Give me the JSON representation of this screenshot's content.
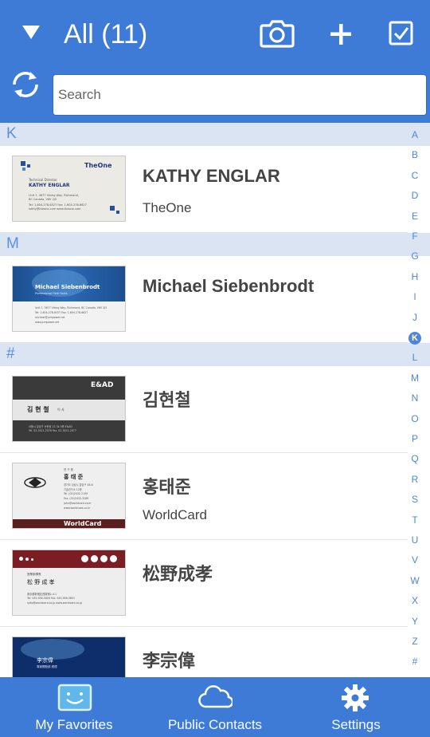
{
  "header": {
    "title": "All (11)",
    "search_placeholder": "Search"
  },
  "sections": [
    {
      "letter": "K"
    },
    {
      "letter": "M"
    },
    {
      "letter": "#"
    }
  ],
  "contacts": [
    {
      "name": "KATHY ENGLAR",
      "company": "TheOne",
      "card": {
        "brand": "TheOne",
        "title_line": "Technical Director",
        "name_line": "KATHY ENGLAR",
        "addr1": "Unit 7, 3677 Viking Way, Richmond,",
        "addr2": "BC Canada, V6V 2J5",
        "phone": "Tel: 1-604-278-6527     Fax: 1-604-278-6627",
        "web": "kathy@theone.com     www.theone.com"
      }
    },
    {
      "name": "Michael Siebenbrodt",
      "company": "",
      "card": {
        "name_line": "Michael Siebenbrodt",
        "title_line": "Professional Field Sales",
        "addr1": "Unit 7, 3677 Viking Way, Richmond, BC Canada, V6V 2J5",
        "phone": "Tel: 1-604-278-6337   Fax: 1-604-278-6627",
        "web": "michael@jumpower.net",
        "web2": "www.jumpower.net"
      }
    },
    {
      "name": "김현철",
      "company": "",
      "card": {
        "brand": "E&AD",
        "name_line": "김 현 철",
        "title_line": "이 사",
        "addr1": "서울시 강남구 논현동 12-34 5층 E&AD",
        "phone": "Tel. 02-3421-2076    Fax. 02-3421-2077"
      }
    },
    {
      "name": "홍태준",
      "company": "WorldCard",
      "card": {
        "brand": "WorldCard",
        "title_line": "연 구 원",
        "name_line": "홍 태 준",
        "addr1": "경기도 성남시 분당구 48-8",
        "addr2": "기술연구소 12층",
        "phone": "Tel. (02)2432-2199",
        "fax": "Fax. (02)2432-3289",
        "web": "john@worldcard.co.kr",
        "web2": "www.worldcard.co.kr"
      }
    },
    {
      "name": "松野成孝",
      "company": "",
      "card": {
        "title_line": "営業部課長",
        "name_line": "松 野 成 孝",
        "addr1": "東京都新宿区西新宿2-4-1",
        "phone": "Tel: 045-956-5600    Fax: 045-956-5601",
        "web": "seito@worldcard.co.jp   www.worldcard.co.jp"
      }
    },
    {
      "name": "李宗偉",
      "company": "",
      "card": {
        "name_line": "李宗偉",
        "title_line": "專案開發部   經理"
      }
    }
  ],
  "alpha_index": [
    "A",
    "B",
    "C",
    "D",
    "E",
    "F",
    "G",
    "H",
    "I",
    "J",
    "K",
    "L",
    "M",
    "N",
    "O",
    "P",
    "Q",
    "R",
    "S",
    "T",
    "U",
    "V",
    "W",
    "X",
    "Y",
    "Z",
    "#"
  ],
  "alpha_active": "K",
  "bottom_nav": [
    {
      "label": "My Favorites",
      "icon": "smiley-face-icon"
    },
    {
      "label": "Public Contacts",
      "icon": "cloud-icon"
    },
    {
      "label": "Settings",
      "icon": "gear-icon"
    }
  ],
  "colors": {
    "primary": "#3d7bd6",
    "section_bg": "#dbe4f3",
    "index_text": "#4f86da"
  }
}
